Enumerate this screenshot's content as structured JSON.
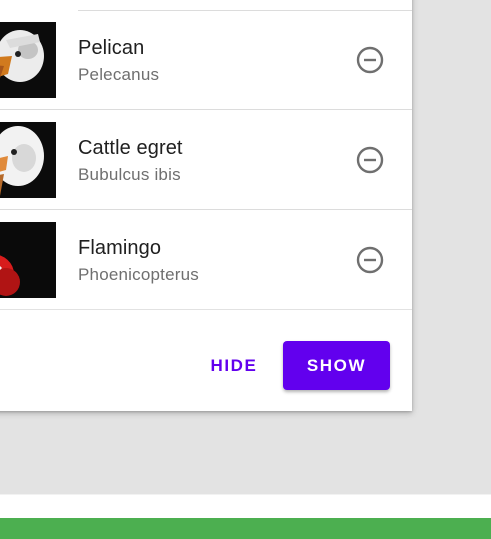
{
  "birds": [
    {
      "name": "Pelican",
      "scientific_name": "Pelecanus",
      "icon": "remove-circle-icon"
    },
    {
      "name": "Cattle egret",
      "scientific_name": "Bubulcus ibis",
      "icon": "remove-circle-icon"
    },
    {
      "name": "Flamingo",
      "scientific_name": "Phoenicopterus",
      "icon": "remove-circle-icon"
    }
  ],
  "actions": {
    "hide_label": "HIDE",
    "show_label": "SHOW"
  },
  "colors": {
    "accent": "#6200ee",
    "bottom_bar": "#4caf50",
    "backdrop": "#e3e3e3",
    "flamingo": "#d81c1c"
  }
}
